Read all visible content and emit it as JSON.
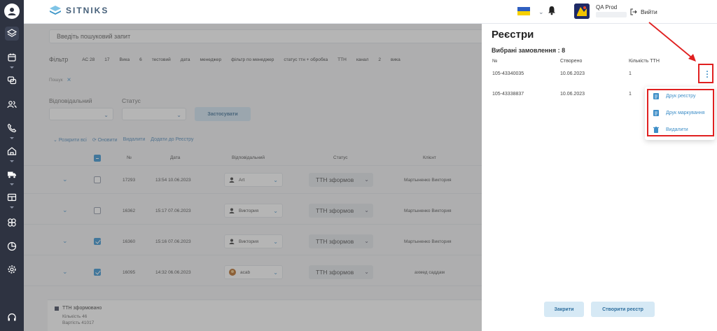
{
  "app": {
    "logo_text": "SITNIKS"
  },
  "topbar": {
    "language": "uk",
    "user_name": "QA Prod",
    "logout_label": "Вийти"
  },
  "sidebar": {
    "items": [
      "profile-icon",
      "layers-icon",
      "calendar-icon",
      "chat-icon",
      "users-icon",
      "phone-icon",
      "home-icon",
      "truck-icon",
      "table-icon",
      "integrations-icon",
      "analytics-icon",
      "settings-icon",
      "support-icon"
    ]
  },
  "main": {
    "search_placeholder": "Введіть пошуковий запит",
    "filter_label": "Фільтр",
    "filter_chips": [
      "AC 28",
      "17",
      "Вика",
      "6",
      "тестовий",
      "дата",
      "менеджер",
      "фільтр по менеджер",
      "статус ттн + обробка",
      "ТТН",
      "канал",
      "2",
      "вика"
    ],
    "search_tag": "Пошук",
    "responsible_label": "Відповідальний",
    "status_label": "Статус",
    "apply_label": "Застосувати",
    "actions": [
      "Розкрити всі",
      "Оновити",
      "Видалити",
      "Додати до Реєстру"
    ],
    "columns": [
      "№",
      "Дата",
      "Відповідальний",
      "Статус",
      "Клієнт"
    ],
    "rows": [
      {
        "id": "17293",
        "date": "13:54 10.06.2023",
        "responsible": "Art",
        "status": "ТТН зформов",
        "client": "Мартыненко Виктория",
        "checked": false
      },
      {
        "id": "16362",
        "date": "15:17 07.06.2023",
        "responsible": "Виктория",
        "status": "ТТН зформов",
        "client": "Мартыненко Виктория",
        "checked": false
      },
      {
        "id": "16360",
        "date": "15:16 07.06.2023",
        "responsible": "Виктория",
        "status": "ТТН зформов",
        "client": "Мартыненко Виктория",
        "checked": true
      },
      {
        "id": "16095",
        "date": "14:32 06.06.2023",
        "responsible": "acab",
        "status": "ТТН зформов",
        "client": "ахмед саддам",
        "checked": true
      }
    ],
    "summary": {
      "title": "ТТН зформовано",
      "count_line": "Кількість 46",
      "cost_line": "Вартість 41017"
    }
  },
  "panel": {
    "title": "Реєстри",
    "selected_orders": "Вибрані замовлення : 8",
    "columns": [
      "№",
      "Створено",
      "Кількість ТТН"
    ],
    "rows": [
      {
        "number": "105-43340035",
        "created": "10.06.2023",
        "count": "1"
      },
      {
        "number": "105-43338837",
        "created": "10.06.2023",
        "count": "1"
      }
    ],
    "menu": [
      {
        "label": "Друк реєстру",
        "icon": "print-icon"
      },
      {
        "label": "Друк маркування",
        "icon": "print-icon"
      },
      {
        "label": "Видалити",
        "icon": "trash-icon"
      }
    ],
    "close_label": "Закрити",
    "create_label": "Створити реєстр"
  },
  "colors": {
    "accent": "#3f8fc8",
    "annotation": "#e02020",
    "sidebar": "#2e3341"
  }
}
